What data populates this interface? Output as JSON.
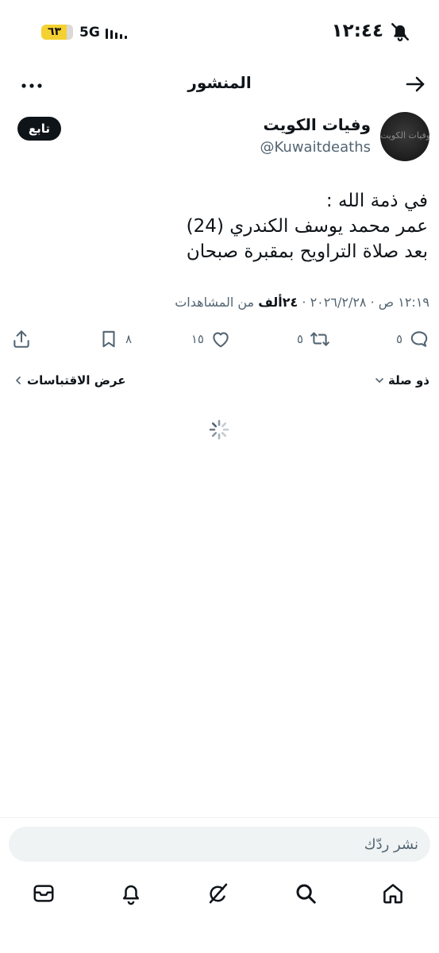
{
  "status_bar": {
    "time": "١٢:٤٤",
    "battery_level": "٦٣",
    "network": "5G"
  },
  "header": {
    "title": "المنشور"
  },
  "post": {
    "author_name": "وفيات الكويت",
    "author_handle": "@Kuwaitdeaths",
    "avatar_text": "وفيات الكويت",
    "follow_label": "تابع",
    "lines": [
      "في ذمة الله :",
      "عمر محمد يوسف الكندري (24)",
      "بعد صلاة التراويح بمقبرة صبحان"
    ],
    "time": "١٢:١٩ ص",
    "date": "٢٠٢٦/٢/٢٨",
    "views_count": "٢٤ألف",
    "views_label": "من المشاهدات",
    "separator": "·"
  },
  "actions": {
    "reply_count": "٥",
    "repost_count": "٥",
    "like_count": "١٥",
    "bookmark_count": "٨"
  },
  "related": {
    "label": "ذو صلة",
    "quotes_label": "عرض الاقتباسات"
  },
  "reply": {
    "placeholder": "نشر ردّك"
  },
  "icons": {
    "back": "arrow-right-icon",
    "more": "more-horizontal-icon",
    "reply": "comment-icon",
    "repost": "repost-icon",
    "like": "heart-icon",
    "bookmark": "bookmark-icon",
    "share": "share-icon",
    "chevron": "chevron-down-icon",
    "loading": "spinner-icon",
    "nav": [
      "home-icon",
      "search-icon",
      "grok-icon",
      "bell-icon",
      "mail-icon"
    ]
  },
  "colors": {
    "text": "#0f1419",
    "secondary": "#536471",
    "follow_bg": "#0f1419",
    "reply_bg": "#eff3f4",
    "battery": "#f4d130"
  }
}
